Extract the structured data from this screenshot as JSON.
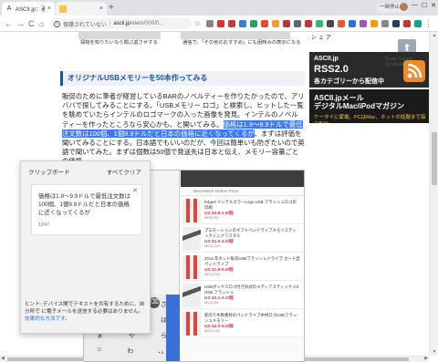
{
  "browser": {
    "tabs": [
      {
        "favicon": "A",
        "title": "ASCII.jp：通常やGoogle, スマホ",
        "close": "×"
      },
      {
        "favicon": "",
        "title": "",
        "close": "×"
      }
    ],
    "new_tab": "+",
    "user_button": "一時停止中",
    "window_controls": {
      "minimize": "—",
      "maximize": "☐",
      "close": "✕"
    },
    "nav": {
      "back": "←",
      "forward": "→",
      "reload": "C",
      "home": "⌂"
    },
    "address": {
      "security": "保護されていない",
      "host": "ascii.jp",
      "path": "/elem/000/0..."
    },
    "star": "☆",
    "menu": "⋮"
  },
  "article": {
    "thumb_captions": [
      "探物を知りたいなら聞ぶ返させする",
      "通信で、「その他のおすすめ」にも困時みの表示になる"
    ],
    "section_heading": "オリジナルUSBメモリーを50本作ってみる",
    "paragraph_before": "販促のために筆者が経営しているBARのノベルティーを作りたかったので、アリババで探してみることにする。「USBメモリー ロゴ」と検索し、ヒットした一覧を眺めていたらインテルのロゴマークの入った画像を発見。インテルのノベルティーを作ったところなら安心かも、と開いてみる。",
    "paragraph_highlight": "価格は1.9〜9.9ドルで最低注文数は100個、1個9.9ドルだと日本の価格に近くなってくるが",
    "paragraph_after": "、まずは評価を聞いてみることにする。日本語でもいいのだが、今回は簡単いも防ぎたいので英語で聞いてみた。まずは個数は50個で発送先は日本と伝え、メモリー容量ごとの価格"
  },
  "sidebar": {
    "share_text": "シェア",
    "rss_brand": "ASCII.jp",
    "rss_title": "RSS2.0",
    "rss_sub": "各カテゴリーから配信中",
    "rss_ghost": "Really Simple Syndication",
    "mail_brand": "ASCII.jpメール",
    "mail_title": "デジタルMac/iPodマガジン",
    "mail_sub": "ケータイに家電、PCはMac、ネットの話題まで毎日配信",
    "scroll_top": "⬆"
  },
  "clipboard": {
    "title": "クリップボード",
    "clear_all": "すべてクリア",
    "item_text": "価格は1.9〜9.9ドルで最低注文数は100個、1個9.9ドルだと日本の価格に近くなってくるが",
    "item_count": "1247",
    "item_close": "✕",
    "hint_text": "ヒント: デバイス間でテキストを共有するために、自分所で に電子メールを送信する必要はありません。",
    "hint_link": "効果的な方法です。"
  },
  "phone": {
    "ime_strip": "の  と  こ  を  は  が",
    "tabs_text": "Best Match   Orders   Price",
    "keyboard_rows": [
      [
        "あ",
        "か",
        "さ"
      ],
      [
        "た",
        "な",
        "は"
      ],
      [
        "ま",
        "や",
        "ら"
      ],
      [
        "☺",
        "わ",
        "、。"
      ]
    ],
    "items": [
      {
        "title": "Edge4 インテルカラーLogo USB フラッシュロゴの印刷",
        "price": "US $0.8-1.9/個",
        "sub": "MOQ:50"
      },
      {
        "title": "プロモーションのギフトペンドライブメモリスティックミニクリスタル",
        "price": "US $1.5-4.5/個",
        "sub": "MOQ:100"
      },
      {
        "title": "2016 年ホット販売USBフラッシュドライブ カード型ペンドライブ",
        "price": "US $1.9-9.9/個",
        "sub": "MOQ:100"
      },
      {
        "title": "USBボックスロゴ付き形式のメディアスティック 2.0 USB フラッシュ",
        "price": "US $2.1-4.2/個",
        "sub": "MOQ:50"
      },
      {
        "title": "卸売り木製素材のペンドライブ木材ロゴUSBフラッシュメモリー",
        "price": "US $2.0-5.5/個",
        "sub": "MOQ:100"
      }
    ]
  },
  "colors": {
    "accent_blue": "#1c55a3",
    "highlight": "#3b78ff",
    "rss_orange": "#f08a24"
  }
}
